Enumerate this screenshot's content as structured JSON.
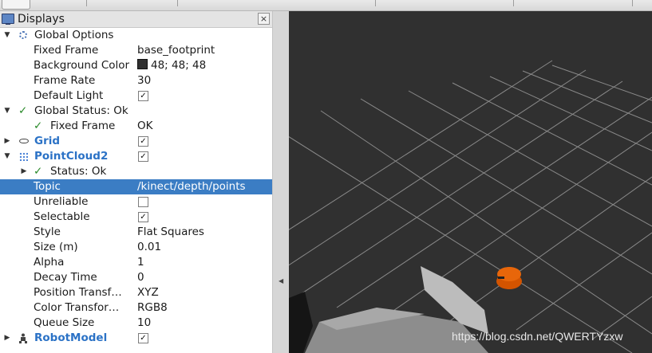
{
  "colors": {
    "viewport_background": "#303030",
    "selection": "#3b7dc4",
    "display_name": "#2b72c6",
    "robot_body": "#d35400"
  },
  "panel": {
    "title": "Displays",
    "close_glyph": "×"
  },
  "tree": {
    "global_options": {
      "label": "Global Options",
      "fixed_frame": {
        "label": "Fixed Frame",
        "value": "base_footprint"
      },
      "background_color": {
        "label": "Background Color",
        "value": "48; 48; 48"
      },
      "frame_rate": {
        "label": "Frame Rate",
        "value": "30"
      },
      "default_light": {
        "label": "Default Light",
        "checked": true
      }
    },
    "global_status": {
      "label": "Global Status: Ok",
      "fixed_frame": {
        "label": "Fixed Frame",
        "value": "OK"
      }
    },
    "grid": {
      "label": "Grid",
      "checked": true
    },
    "pointcloud2": {
      "label": "PointCloud2",
      "checked": true,
      "status": {
        "label": "Status: Ok"
      },
      "topic": {
        "label": "Topic",
        "value": "/kinect/depth/points"
      },
      "unreliable": {
        "label": "Unreliable",
        "checked": false
      },
      "selectable": {
        "label": "Selectable",
        "checked": true
      },
      "style": {
        "label": "Style",
        "value": "Flat Squares"
      },
      "size": {
        "label": "Size (m)",
        "value": "0.01"
      },
      "alpha": {
        "label": "Alpha",
        "value": "1"
      },
      "decay_time": {
        "label": "Decay Time",
        "value": "0"
      },
      "position_transformer": {
        "label": "Position Transf…",
        "value": "XYZ"
      },
      "color_transformer": {
        "label": "Color Transfor…",
        "value": "RGB8"
      },
      "queue_size": {
        "label": "Queue Size",
        "value": "10"
      }
    },
    "robot_model": {
      "label": "RobotModel",
      "checked": true
    }
  },
  "icons": {
    "expanded": "▼",
    "collapsed": "▶",
    "status_ok": "✓",
    "checkbox_checked": "✓",
    "splitter": "◀"
  },
  "watermark": "https://blog.csdn.net/QWERTYzxw"
}
